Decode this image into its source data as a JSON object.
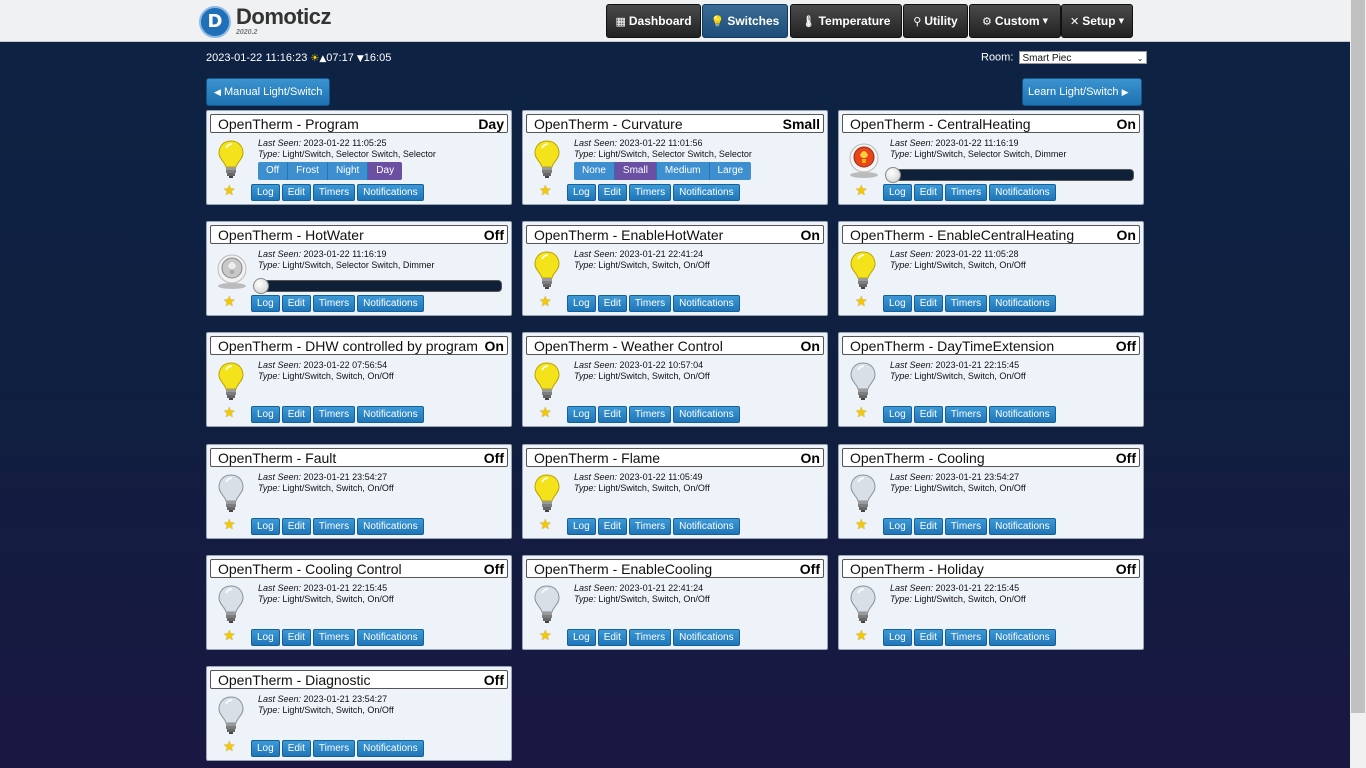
{
  "app": {
    "name": "Domoticz",
    "version": "2020.2",
    "logo_letter": "D"
  },
  "nav": [
    {
      "label": "Dashboard",
      "icon": "dashboard-icon",
      "glyph": "▦",
      "active": false,
      "dropdown": false
    },
    {
      "label": "Switches",
      "icon": "bulb-icon",
      "glyph": "💡",
      "active": true,
      "dropdown": false
    },
    {
      "label": "Temperature",
      "icon": "thermometer-icon",
      "glyph": "🌡",
      "active": false,
      "dropdown": false
    },
    {
      "label": "Utility",
      "icon": "utility-icon",
      "glyph": "⚲",
      "active": false,
      "dropdown": false
    },
    {
      "label": "Custom",
      "icon": "gear-icon",
      "glyph": "⚙",
      "active": false,
      "dropdown": true
    },
    {
      "label": "Setup",
      "icon": "wrench-icon",
      "glyph": "✕",
      "active": false,
      "dropdown": true
    }
  ],
  "infobar": {
    "datetime": "2023-01-22 11:16:23",
    "sunrise": "07:17",
    "sunset": "16:05",
    "room_label": "Room:",
    "room_value": "Smart Piec"
  },
  "actions": {
    "manual": "Manual Light/Switch",
    "learn": "Learn Light/Switch"
  },
  "card_buttons": {
    "log": "Log",
    "edit": "Edit",
    "timers": "Timers",
    "notifications": "Notifications"
  },
  "labels": {
    "last_seen": "Last Seen:",
    "type": "Type:"
  },
  "colors": {
    "bulb_on": "#f4e21a",
    "bulb_off": "#d9dfe6",
    "accent": "#1f75b8",
    "selected_level": "#6a4fa3"
  },
  "devices": [
    {
      "name": "OpenTherm - Program",
      "status": "Day",
      "last_seen": "2023-01-22 11:05:25",
      "type": "Light/Switch, Selector Switch, Selector",
      "icon": "on",
      "control": "selector",
      "levels": [
        "Off",
        "Frost",
        "Night",
        "Day"
      ],
      "selected": 3
    },
    {
      "name": "OpenTherm - Curvature",
      "status": "Small",
      "last_seen": "2023-01-22 11:01:56",
      "type": "Light/Switch, Selector Switch, Selector",
      "icon": "on",
      "control": "selector",
      "levels": [
        "None",
        "Small",
        "Medium",
        "Large"
      ],
      "selected": 1
    },
    {
      "name": "OpenTherm - CentralHeating",
      "status": "On",
      "last_seen": "2023-01-22 11:16:19",
      "type": "Light/Switch, Selector Switch, Dimmer",
      "icon": "dimmer-on",
      "control": "slider",
      "level": 0
    },
    {
      "name": "OpenTherm - HotWater",
      "status": "Off",
      "last_seen": "2023-01-22 11:16:19",
      "type": "Light/Switch, Selector Switch, Dimmer",
      "icon": "dimmer-off",
      "control": "slider",
      "level": 0
    },
    {
      "name": "OpenTherm - EnableHotWater",
      "status": "On",
      "last_seen": "2023-01-21 22:41:24",
      "type": "Light/Switch, Switch, On/Off",
      "icon": "on",
      "control": "none"
    },
    {
      "name": "OpenTherm - EnableCentralHeating",
      "status": "On",
      "last_seen": "2023-01-22 11:05:28",
      "type": "Light/Switch, Switch, On/Off",
      "icon": "on",
      "control": "none"
    },
    {
      "name": "OpenTherm - DHW controlled by program",
      "status": "On",
      "last_seen": "2023-01-22 07:56:54",
      "type": "Light/Switch, Switch, On/Off",
      "icon": "on",
      "control": "none"
    },
    {
      "name": "OpenTherm - Weather Control",
      "status": "On",
      "last_seen": "2023-01-22 10:57:04",
      "type": "Light/Switch, Switch, On/Off",
      "icon": "on",
      "control": "none"
    },
    {
      "name": "OpenTherm - DayTimeExtension",
      "status": "Off",
      "last_seen": "2023-01-21 22:15:45",
      "type": "Light/Switch, Switch, On/Off",
      "icon": "off",
      "control": "none"
    },
    {
      "name": "OpenTherm - Fault",
      "status": "Off",
      "last_seen": "2023-01-21 23:54:27",
      "type": "Light/Switch, Switch, On/Off",
      "icon": "off",
      "control": "none"
    },
    {
      "name": "OpenTherm - Flame",
      "status": "On",
      "last_seen": "2023-01-22 11:05:49",
      "type": "Light/Switch, Switch, On/Off",
      "icon": "on",
      "control": "none"
    },
    {
      "name": "OpenTherm - Cooling",
      "status": "Off",
      "last_seen": "2023-01-21 23:54:27",
      "type": "Light/Switch, Switch, On/Off",
      "icon": "off",
      "control": "none"
    },
    {
      "name": "OpenTherm - Cooling Control",
      "status": "Off",
      "last_seen": "2023-01-21 22:15:45",
      "type": "Light/Switch, Switch, On/Off",
      "icon": "off",
      "control": "none"
    },
    {
      "name": "OpenTherm - EnableCooling",
      "status": "Off",
      "last_seen": "2023-01-21 22:41:24",
      "type": "Light/Switch, Switch, On/Off",
      "icon": "off",
      "control": "none"
    },
    {
      "name": "OpenTherm - Holiday",
      "status": "Off",
      "last_seen": "2023-01-21 22:15:45",
      "type": "Light/Switch, Switch, On/Off",
      "icon": "off",
      "control": "none"
    },
    {
      "name": "OpenTherm - Diagnostic",
      "status": "Off",
      "last_seen": "2023-01-21 23:54:27",
      "type": "Light/Switch, Switch, On/Off",
      "icon": "off",
      "control": "none"
    }
  ]
}
